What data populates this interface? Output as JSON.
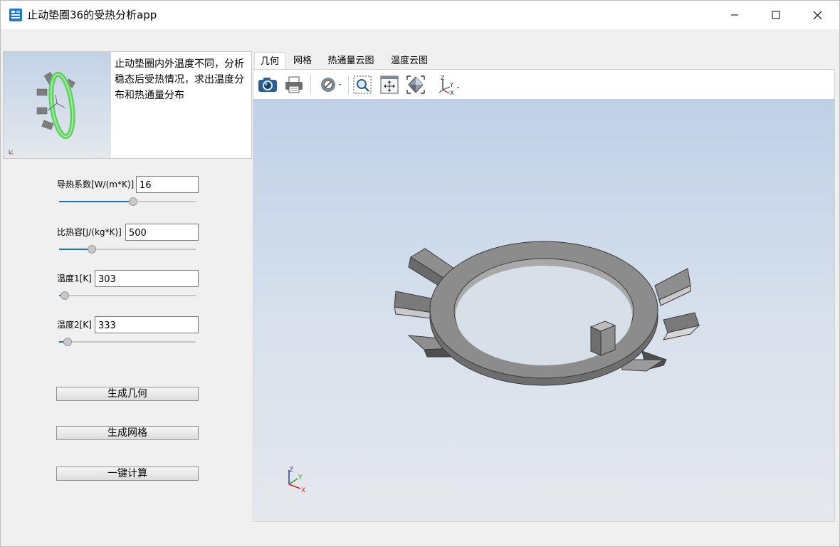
{
  "window": {
    "title": "止动垫圈36的受热分析app",
    "minimize_icon": "minimize-icon",
    "maximize_icon": "maximize-icon",
    "close_icon": "close-icon"
  },
  "preview": {
    "description": "止动垫圈内外温度不同，分析稳态后受热情况，求出温度分布和热通量分布"
  },
  "params": [
    {
      "label": "导热系数[W/(m*K)]",
      "value": "16",
      "slider": 0.54
    },
    {
      "label": "比热容[J/(kg*K)]",
      "value": "500",
      "slider": 0.24
    },
    {
      "label": "温度1[K]",
      "value": "303",
      "slider": 0.04
    },
    {
      "label": "温度2[K]",
      "value": "333",
      "slider": 0.06
    }
  ],
  "buttons": {
    "gen_geometry": "生成几何",
    "gen_mesh": "生成网格",
    "compute": "一键计算"
  },
  "tabs": [
    {
      "label": "几何",
      "active": true
    },
    {
      "label": "网格",
      "active": false
    },
    {
      "label": "热通量云图",
      "active": false
    },
    {
      "label": "温度云图",
      "active": false
    }
  ],
  "toolbar": [
    "camera-icon",
    "print-icon",
    "hide-icon",
    "zoom-box-icon",
    "zoom-extents-icon",
    "fit-view-icon",
    "axis-orientation-icon"
  ],
  "axis_triad": {
    "x": "X",
    "y": "Y",
    "z": "Z"
  },
  "colors": {
    "accent": "#1f6fbf",
    "part_gray": "#8a8a8a",
    "preview_ring": "#6fe06f"
  }
}
